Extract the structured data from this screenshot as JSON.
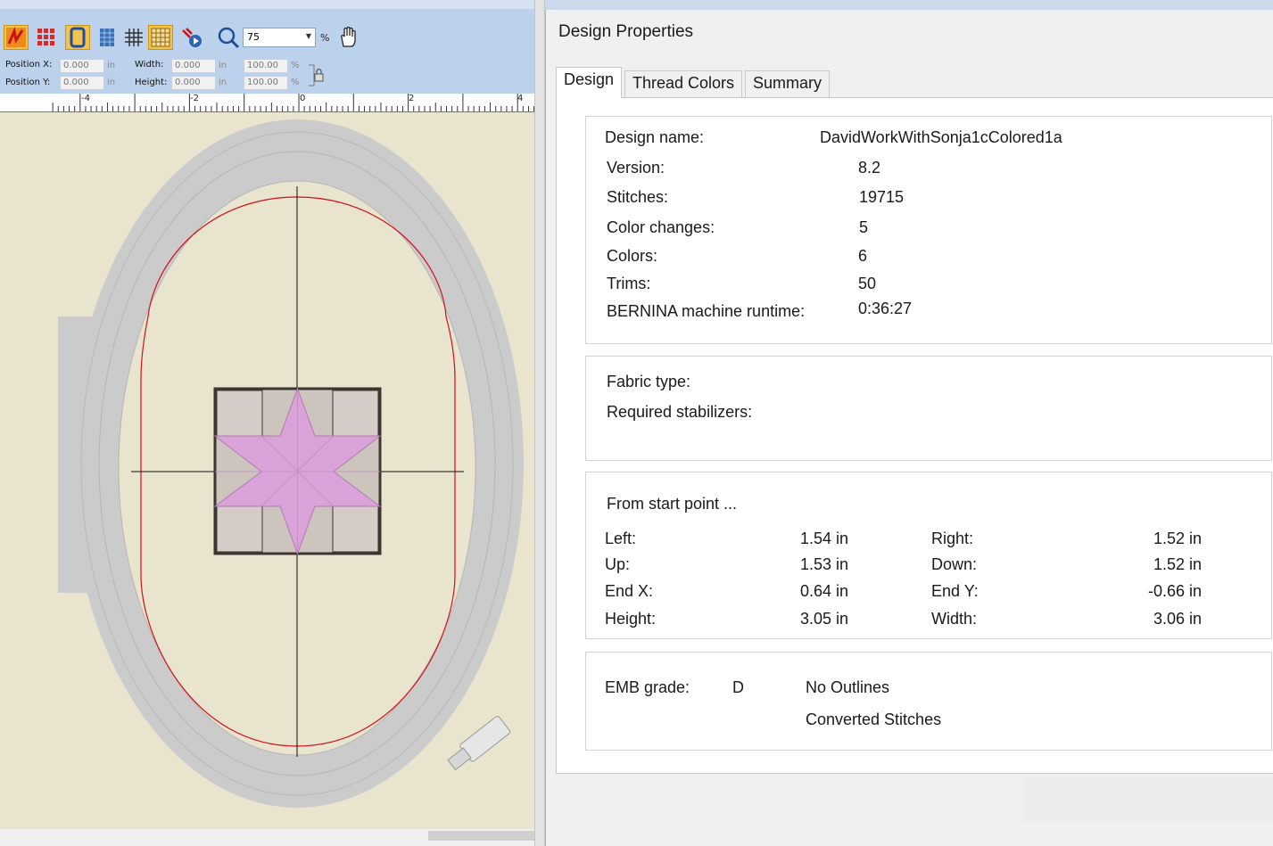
{
  "toolbar": {
    "buttons": [
      {
        "name": "stitch-player-icon",
        "active": true
      },
      {
        "name": "show-stitches-icon",
        "active": false
      },
      {
        "name": "show-hoop-icon",
        "active": true
      },
      {
        "name": "show-grid-icon",
        "active": false
      },
      {
        "name": "grid-icon",
        "active": false
      },
      {
        "name": "show-ruler-icon",
        "active": true
      },
      {
        "name": "slow-redraw-icon",
        "active": false
      },
      {
        "name": "zoom-icon",
        "active": false
      },
      {
        "name": "pan-hand-icon",
        "active": false
      }
    ],
    "zoom_value": "75",
    "zoom_unit": "%"
  },
  "position": {
    "x_label": "Position X:",
    "y_label": "Position Y:",
    "x_value": "0.000",
    "y_value": "0.000",
    "unit": "in"
  },
  "size": {
    "width_label": "Width:",
    "height_label": "Height:",
    "width_value": "0.000",
    "height_value": "0.000",
    "unit": "in",
    "width_percent": "100.00",
    "height_percent": "100.00",
    "percent_unit": "%"
  },
  "ruler": {
    "labels": [
      "-4",
      "-2",
      "0",
      "2",
      "4"
    ]
  },
  "colors": {
    "canvas_bg": "#e9e4ce",
    "hoop": "#cbcbcb",
    "sew_field": "#d0101a",
    "star": "#d9a2d9",
    "block_bg": "#cdc4bd",
    "block_border": "#3d3532"
  },
  "dialog": {
    "title": "Design Properties",
    "tabs": [
      "Design",
      "Thread Colors",
      "Summary"
    ],
    "selected_tab": "Design",
    "design": {
      "name_label": "Design name:",
      "name_value": "DavidWorkWithSonja1cColored1a",
      "rows": [
        {
          "label": "Version:",
          "value": "8.2"
        },
        {
          "label": "Stitches:",
          "value": "19715"
        },
        {
          "label": "Color changes:",
          "value": "5"
        },
        {
          "label": "Colors:",
          "value": "6"
        },
        {
          "label": "Trims:",
          "value": "50"
        },
        {
          "label": "BERNINA machine runtime:",
          "value": "0:36:27"
        }
      ]
    },
    "fabric": {
      "fabric_label": "Fabric type:",
      "stabilizer_label": "Required stabilizers:"
    },
    "start_point": {
      "heading": "From start point ...",
      "rows": [
        {
          "l_label": "Left:",
          "l_value": "1.54 in",
          "r_label": "Right:",
          "r_value": "1.52 in"
        },
        {
          "l_label": "Up:",
          "l_value": "1.53 in",
          "r_label": "Down:",
          "r_value": "1.52 in"
        },
        {
          "l_label": "End X:",
          "l_value": "0.64 in",
          "r_label": "End Y:",
          "r_value": "-0.66 in"
        },
        {
          "l_label": "Height:",
          "l_value": "3.05 in",
          "r_label": "Width:",
          "r_value": "3.06 in"
        }
      ]
    },
    "emb": {
      "grade_label": "EMB grade:",
      "grade_value": "D",
      "note1": "No Outlines",
      "note2": "Converted Stitches"
    }
  }
}
